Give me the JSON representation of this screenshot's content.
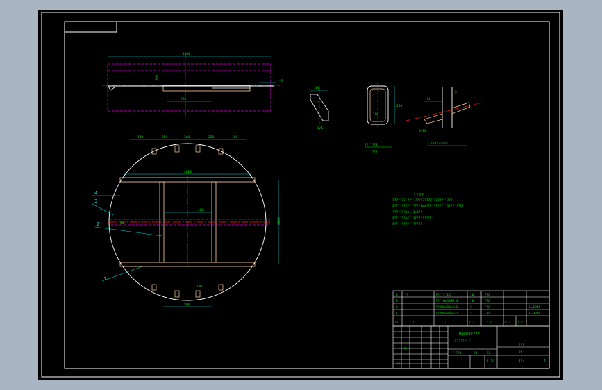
{
  "colors": {
    "page": "#a9b5c2",
    "sheet": "#000000",
    "border": "#ffffff",
    "dim": "#00d8d8",
    "text": "#00e000",
    "center": "#ff2020",
    "hidden": "#e000e0",
    "part": "#ffd0a0"
  },
  "top_view": {
    "total_len": "1880",
    "offset": "300",
    "span": "700",
    "thick": "t-5"
  },
  "section_a": {
    "d1": "100",
    "d2": "t-5",
    "caption": "1/11"
  },
  "section_b": {
    "d1": "250",
    "d2": "100",
    "caption1": "??????1",
    "caption2": "????"
  },
  "section_c": {
    "d1": "60",
    "d2": "8",
    "d3": "5~10",
    "caption": "??1?????1?2"
  },
  "plan": {
    "top_dims": [
      "100",
      "250",
      "300",
      "250",
      "100"
    ],
    "chord_top": "2600",
    "mid_dim": "400",
    "side_dim": "2000",
    "left_dim": "50",
    "bottom_dim": "500",
    "bot_small": "100",
    "callouts": [
      "4",
      "3",
      "2",
      "1"
    ]
  },
  "notes": {
    "title": "????",
    "lines": [
      "1??????:???,????????????????????",
      "2?????????????/4mm???????????1??????1?",
      "????1??tel-1.1??",
      "3??????t???1??????????",
      "4??????????????2"
    ]
  },
  "bom": {
    "rows": [
      {
        "no": "4",
        "name": "??",
        "spec": "????1-15",
        "qty": "10",
        "mat": "FRP",
        "note": ""
      },
      {
        "no": "3",
        "name": "",
        "spec": "????6m400Mi4",
        "qty": "10",
        "mat": "FRP",
        "note": ""
      },
      {
        "no": "2",
        "name": "",
        "spec": "???80x80x6x2",
        "qty": "2",
        "mat": "FRP",
        "note": "L=1940"
      },
      {
        "no": "1",
        "name": "",
        "spec": "???80x80x6x2",
        "qty": "2",
        "mat": "FRP",
        "note": "L=3240"
      }
    ],
    "header": [
      "??",
      "?  1",
      "?  ?",
      "?  ?",
      "?  ?",
      "? ?",
      "? ?"
    ]
  },
  "title_block": {
    "drawing_title": "DN3000???",
    "drawing_sub": "??????1??",
    "company": "???",
    "name2": "??",
    "scale": "1:20",
    "sheet": "1?? ",
    "page": "4",
    "row_a": "????1",
    "row_b": "?1",
    "row_c": "?2",
    "label_a": "?????",
    "label_b": "???"
  }
}
